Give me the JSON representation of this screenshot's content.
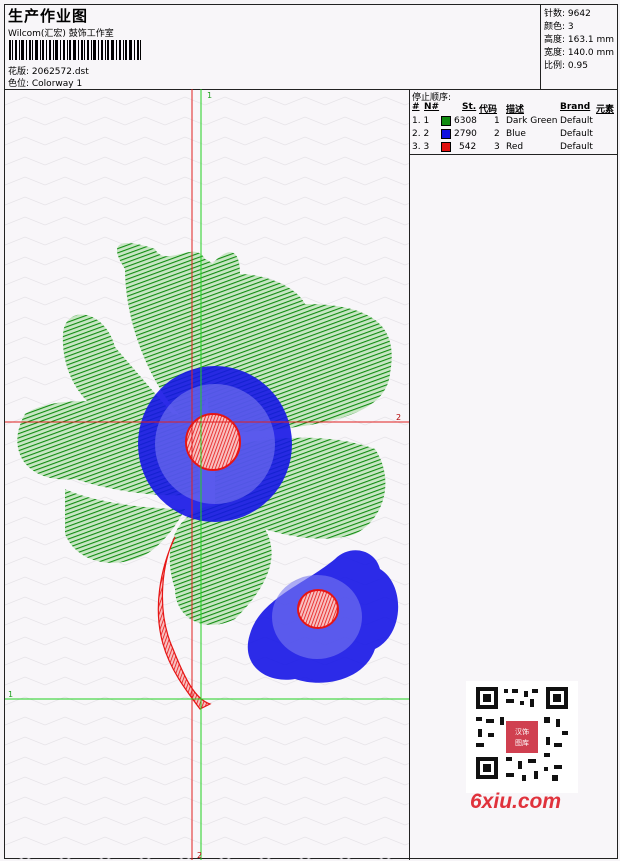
{
  "header": {
    "title": "生产作业图",
    "company": "Wilcom(汇宏) 鼓饰工作室",
    "design_label": "花版: 2062572.dst",
    "colorway_label": "色位: Colorway 1"
  },
  "stats": {
    "stitches": "针数: 9642",
    "colors": "颜色: 3",
    "height": "高度: 163.1 mm",
    "width": "宽度: 140.0 mm",
    "scale": "比例: 0.95"
  },
  "stop_sequence": {
    "title": "停止顺序:",
    "headers": [
      "#",
      "N#",
      "St.",
      "代码",
      "描述",
      "Brand",
      "元素"
    ],
    "rows": [
      {
        "idx": "1. 1",
        "color": "#108a10",
        "stitches": "6308",
        "code": "1",
        "desc": "Dark Green",
        "brand": "Default"
      },
      {
        "idx": "2. 2",
        "color": "#1010e0",
        "stitches": "2790",
        "code": "2",
        "desc": "Blue",
        "brand": "Default"
      },
      {
        "idx": "3. 3",
        "color": "#e01010",
        "stitches": "542",
        "code": "3",
        "desc": "Red",
        "brand": "Default"
      }
    ]
  },
  "guides": {
    "v1": "1",
    "v2": "2",
    "h1": "1",
    "h2": "2"
  },
  "watermark": {
    "site": "6xiu.com",
    "qr_center": "汉饰图库"
  },
  "colors": {
    "green": "#118c11",
    "blue": "#1515e6",
    "red": "#e61515",
    "guide_red": "#e02020",
    "guide_green": "#20d020"
  }
}
